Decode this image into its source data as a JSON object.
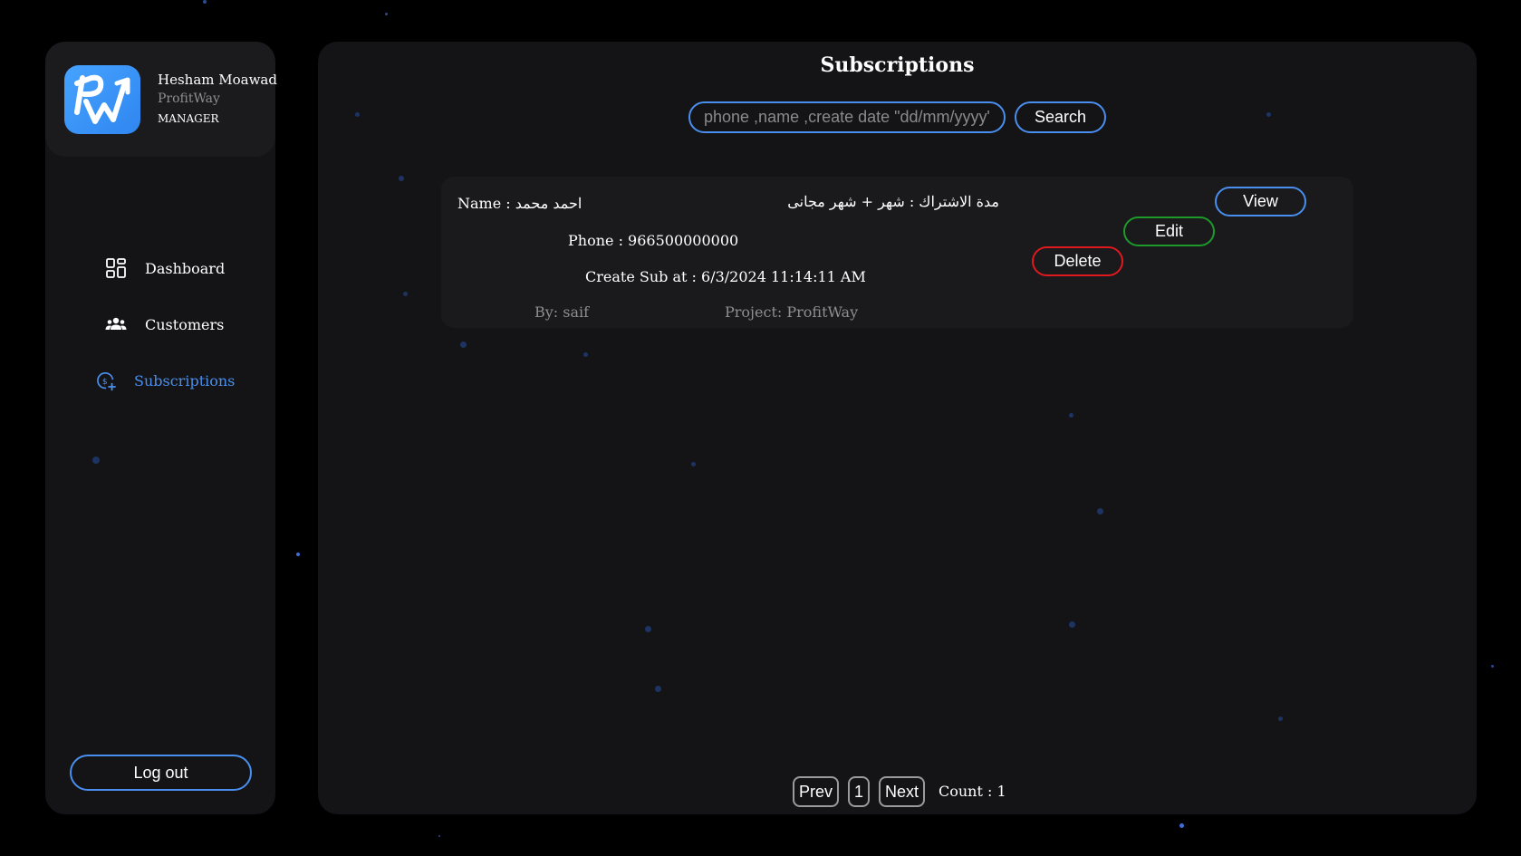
{
  "sidebar": {
    "profile": {
      "name": "Hesham Moawad",
      "company": "ProfitWay",
      "role": "MANAGER",
      "logo_icon": "profitway-logo-icon"
    },
    "nav": [
      {
        "label": "Dashboard",
        "icon": "dashboard-grid-icon",
        "active": false
      },
      {
        "label": "Customers",
        "icon": "customers-group-icon",
        "active": false
      },
      {
        "label": "Subscriptions",
        "icon": "subscription-dollar-icon",
        "active": true
      }
    ],
    "logout_label": "Log out"
  },
  "main": {
    "title": "Subscriptions",
    "search": {
      "placeholder": "phone ,name ,create date \"dd/mm/yyyy\"",
      "value": "",
      "button_label": "Search"
    },
    "subscriptions": [
      {
        "name_line": "Name : احمد محمد",
        "duration_line": "مدة الاشتراك : شهر + شهر مجانى",
        "phone_line": "Phone : 966500000000",
        "created_line": "Create Sub at : 6/3/2024 11:14:11 AM",
        "by_line": "By: saif",
        "project_line": "Project: ProfitWay",
        "view_label": "View",
        "edit_label": "Edit",
        "delete_label": "Delete"
      }
    ],
    "pagination": {
      "prev_label": "Prev",
      "current_page": "1",
      "next_label": "Next",
      "count_text": "Count : 1"
    }
  },
  "colors": {
    "accent": "#4a8fef",
    "edit": "#1e9a2a",
    "delete": "#e0191f",
    "panel": "#141416",
    "background": "#000000"
  }
}
